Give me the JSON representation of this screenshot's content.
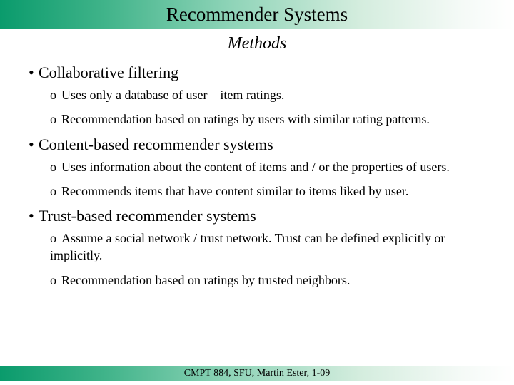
{
  "header": {
    "title": "Recommender Systems",
    "subtitle": "Methods"
  },
  "sections": [
    {
      "heading": "Collaborative filtering",
      "items": [
        "Uses only a database of user – item ratings.",
        "Recommendation based on ratings by users with similar rating patterns."
      ]
    },
    {
      "heading": "Content-based recommender systems",
      "items": [
        "Uses information about the content of items and / or the properties of users.",
        "Recommends items that have content similar to items liked by user."
      ]
    },
    {
      "heading": "Trust-based recommender systems",
      "items": [
        "Assume a social network / trust network. Trust can be defined explicitly or implicitly.",
        "Recommendation based on ratings by trusted neighbors."
      ]
    }
  ],
  "footer": "CMPT 884, SFU, Martin Ester, 1-09",
  "marks": {
    "bullet": "•",
    "sub": "o"
  }
}
